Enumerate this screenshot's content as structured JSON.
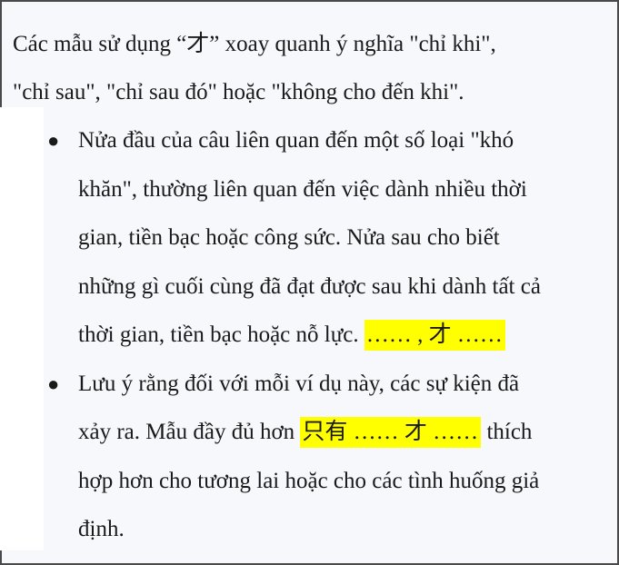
{
  "intro": {
    "line1": "Các mẫu sử dụng “才” xoay quanh ý nghĩa \"chỉ khi\",",
    "line2": "\"chỉ sau\", \"chỉ sau đó\" hoặc \"không cho đến khi\"."
  },
  "bullets": [
    {
      "lines": [
        "Nửa đầu của câu liên quan đến một số loại \"khó",
        "khăn\", thường liên quan đến việc dành nhiều thời",
        "gian, tiền bạc hoặc công sức. Nửa sau cho biết",
        "những gì cuối cùng đã đạt được sau khi dành tất cả"
      ],
      "last_line_text": "thời gian, tiền bạc hoặc nỗ lực.",
      "highlight": "…… , 才 ……"
    },
    {
      "line1_prefix": "Lưu ý rằng đối với mỗi ví dụ này, các sự kiện đã",
      "line2_prefix": "xảy ra. Mẫu đầy đủ hơn",
      "highlight": "只有 …… 才 ……",
      "line2_suffix": "thích",
      "lines_after": [
        "hợp hơn cho tương lai hoặc cho các tình huống giả",
        "định."
      ]
    }
  ],
  "colors": {
    "highlight": "#ffff00",
    "text": "#1a1a1a",
    "background": "#f7f8fc"
  }
}
